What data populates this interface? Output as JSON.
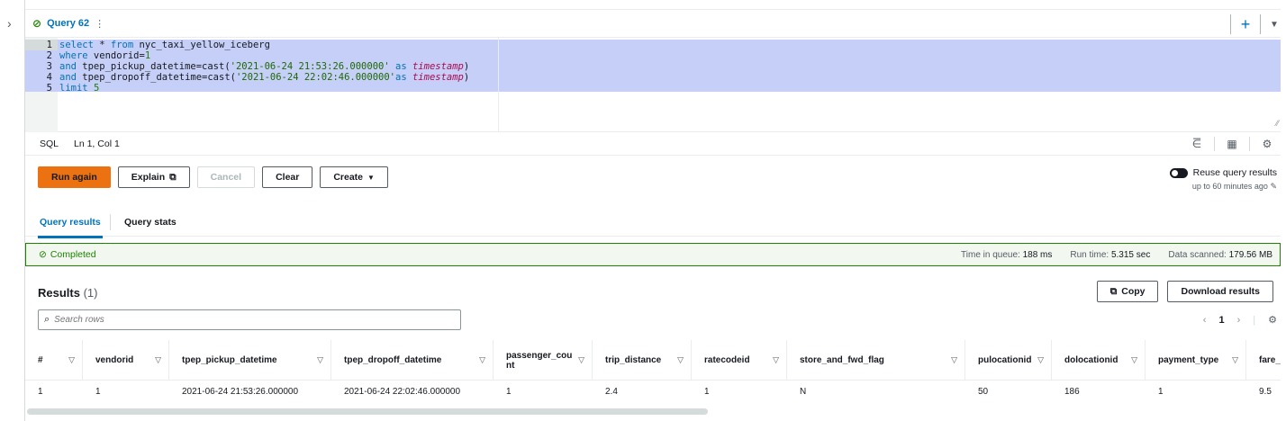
{
  "query_tab": {
    "title": "Query 62",
    "menu": "⋮"
  },
  "editor": {
    "lines": [
      {
        "n": "1",
        "parts": [
          [
            "kw",
            "select"
          ],
          [
            "",
            " * "
          ],
          [
            "kw",
            "from"
          ],
          [
            "",
            " nyc_taxi_yellow_iceberg"
          ]
        ]
      },
      {
        "n": "2",
        "parts": [
          [
            "kw",
            "where"
          ],
          [
            "",
            " vendorid="
          ],
          [
            "num",
            "1"
          ]
        ]
      },
      {
        "n": "3",
        "parts": [
          [
            "kw",
            "and"
          ],
          [
            "",
            " tpep_pickup_datetime=cast("
          ],
          [
            "str",
            "'2021-06-24 21:53:26.000000'"
          ],
          [
            "",
            " "
          ],
          [
            "kw",
            "as"
          ],
          [
            "",
            " "
          ],
          [
            "ty",
            "timestamp"
          ],
          [
            "",
            ")"
          ]
        ]
      },
      {
        "n": "4",
        "parts": [
          [
            "kw",
            "and"
          ],
          [
            "",
            " tpep_dropoff_datetime=cast("
          ],
          [
            "str",
            "'2021-06-24 22:02:46.000000'"
          ],
          [
            "kw",
            "as"
          ],
          [
            "",
            " "
          ],
          [
            "ty",
            "timestamp"
          ],
          [
            "",
            ")"
          ]
        ]
      },
      {
        "n": "5",
        "parts": [
          [
            "kw",
            "limit"
          ],
          [
            "",
            " "
          ],
          [
            "num",
            "5"
          ]
        ]
      }
    ]
  },
  "status": {
    "language": "SQL",
    "cursor": "Ln 1, Col 1"
  },
  "actions": {
    "run_again": "Run again",
    "explain": "Explain",
    "cancel": "Cancel",
    "clear": "Clear",
    "create": "Create"
  },
  "reuse": {
    "label": "Reuse query results",
    "sub": "up to 60 minutes ago"
  },
  "result_tabs": {
    "results": "Query results",
    "stats": "Query stats"
  },
  "completed": {
    "label": "Completed",
    "queue_key": "Time in queue:",
    "queue_val": "188 ms",
    "run_key": "Run time:",
    "run_val": "5.315 sec",
    "scan_key": "Data scanned:",
    "scan_val": "179.56 MB"
  },
  "results": {
    "title": "Results",
    "count": "(1)",
    "copy": "Copy",
    "download": "Download results",
    "search_placeholder": "Search rows",
    "page": "1"
  },
  "table": {
    "columns": [
      "#",
      "vendorid",
      "tpep_pickup_datetime",
      "tpep_dropoff_datetime",
      "passenger_count",
      "trip_distance",
      "ratecodeid",
      "store_and_fwd_flag",
      "pulocationid",
      "dolocationid",
      "payment_type",
      "fare_a"
    ],
    "rows": [
      [
        "1",
        "1",
        "2021-06-24 21:53:26.000000",
        "2021-06-24 22:02:46.000000",
        "1",
        "2.4",
        "1",
        "N",
        "50",
        "186",
        "1",
        "9.5"
      ]
    ]
  },
  "colors": {
    "accent": "#0073bb",
    "primary_button": "#ec7211",
    "success": "#1d8102",
    "selection": "#c5cff7"
  }
}
